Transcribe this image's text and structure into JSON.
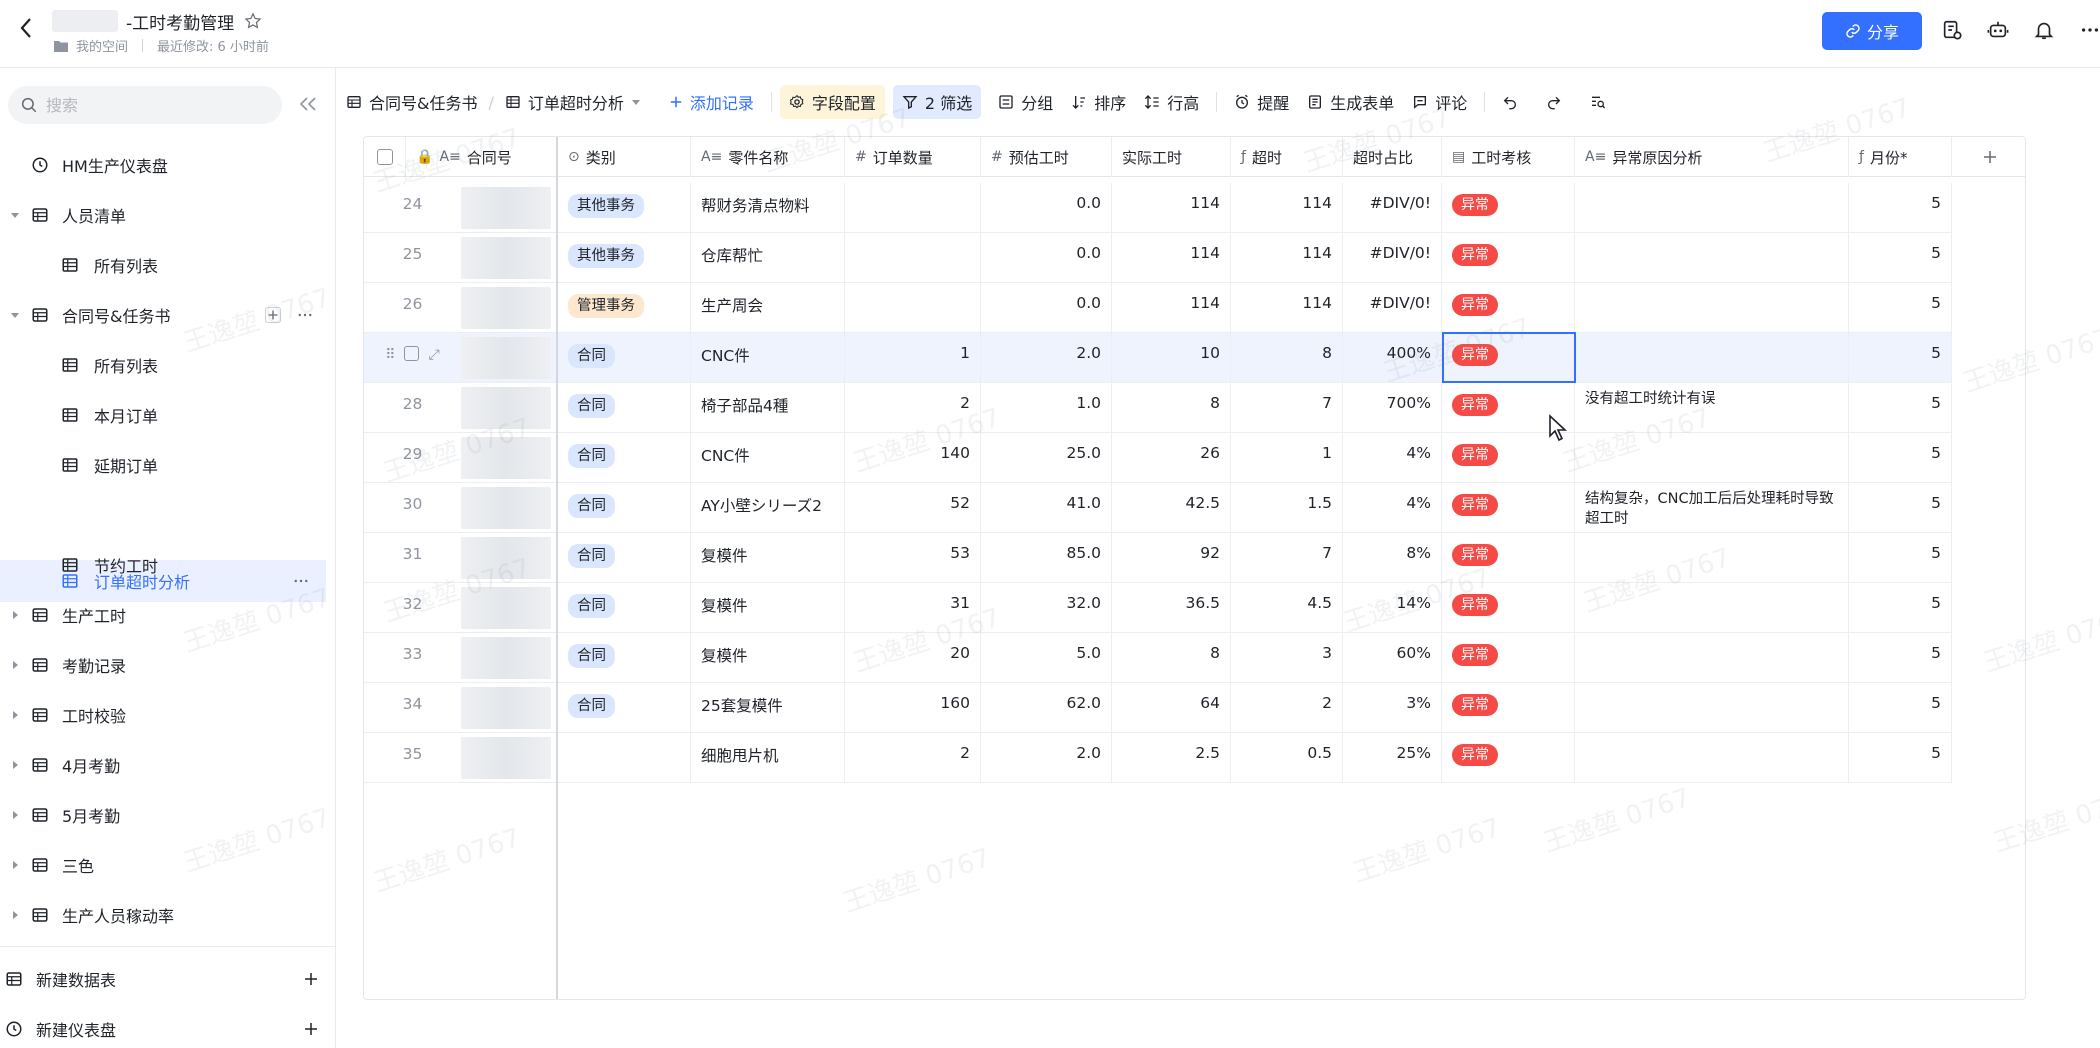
{
  "header": {
    "title": "-工时考勤管理",
    "meta_space": "我的空间",
    "meta_modified": "最近修改: 6 小时前",
    "share_label": "分享"
  },
  "colors": {
    "accent": "#3370ff",
    "abnormal": "#f54a45"
  },
  "sidebar": {
    "search_placeholder": "搜索",
    "items": [
      {
        "label": "HM生产仪表盘",
        "icon": "dashboard-icon"
      },
      {
        "label": "人员清单",
        "icon": "table-icon",
        "expanded": true
      },
      {
        "label": "所有列表",
        "icon": "grid-view-icon"
      },
      {
        "label": "合同号&任务书",
        "icon": "table-icon",
        "expanded": true
      },
      {
        "label": "所有列表",
        "icon": "grid-view-icon"
      },
      {
        "label": "本月订单",
        "icon": "grid-view-icon"
      },
      {
        "label": "延期订单",
        "icon": "grid-view-icon"
      },
      {
        "label": "订单超时分析",
        "icon": "grid-view-icon",
        "active": true
      },
      {
        "label": "节约工时",
        "icon": "grid-view-icon"
      },
      {
        "label": "生产工时",
        "icon": "table-icon"
      },
      {
        "label": "考勤记录",
        "icon": "table-icon"
      },
      {
        "label": "工时校验",
        "icon": "table-icon"
      },
      {
        "label": "4月考勤",
        "icon": "table-icon"
      },
      {
        "label": "5月考勤",
        "icon": "table-icon"
      },
      {
        "label": "三色",
        "icon": "table-icon"
      },
      {
        "label": "生产人员稼动率",
        "icon": "table-icon"
      }
    ],
    "new_table": "新建数据表",
    "new_dashboard": "新建仪表盘"
  },
  "toolbar": {
    "table_name": "合同号&任务书",
    "view_name": "订单超时分析",
    "add_record": "添加记录",
    "field_config": "字段配置",
    "filter": "2 筛选",
    "group": "分组",
    "sort": "排序",
    "row_height": "行高",
    "remind": "提醒",
    "form": "生成表单",
    "comment": "评论"
  },
  "columns": [
    "合同号",
    "类别",
    "零件名称",
    "订单数量",
    "预估工时",
    "实际工时",
    "超时",
    "超时占比",
    "工时考核",
    "异常原因分析",
    "月份*"
  ],
  "rows": [
    {
      "idx": "24",
      "category": "其他事务",
      "cat_color": "blue",
      "part": "帮财务清点物料",
      "qty": "",
      "est": "0.0",
      "actual": "114",
      "over": "114",
      "ratio": "#DIV/0!",
      "check": "异常",
      "reason": "",
      "month": "5"
    },
    {
      "idx": "25",
      "category": "其他事务",
      "cat_color": "blue",
      "part": "仓库帮忙",
      "qty": "",
      "est": "0.0",
      "actual": "114",
      "over": "114",
      "ratio": "#DIV/0!",
      "check": "异常",
      "reason": "",
      "month": "5"
    },
    {
      "idx": "26",
      "category": "管理事务",
      "cat_color": "orange",
      "part": "生产周会",
      "qty": "",
      "est": "0.0",
      "actual": "114",
      "over": "114",
      "ratio": "#DIV/0!",
      "check": "异常",
      "reason": "",
      "month": "5"
    },
    {
      "idx": "",
      "category": "合同",
      "cat_color": "blue",
      "part": "CNC件",
      "qty": "1",
      "est": "2.0",
      "actual": "10",
      "over": "8",
      "ratio": "400%",
      "check": "异常",
      "reason": "",
      "month": "5",
      "selected": true
    },
    {
      "idx": "28",
      "category": "合同",
      "cat_color": "blue",
      "part": "椅子部品4種",
      "qty": "2",
      "est": "1.0",
      "actual": "8",
      "over": "7",
      "ratio": "700%",
      "check": "异常",
      "reason": "没有超工时统计有误",
      "month": "5"
    },
    {
      "idx": "29",
      "category": "合同",
      "cat_color": "blue",
      "part": "CNC件",
      "qty": "140",
      "est": "25.0",
      "actual": "26",
      "over": "1",
      "ratio": "4%",
      "check": "异常",
      "reason": "",
      "month": "5"
    },
    {
      "idx": "30",
      "category": "合同",
      "cat_color": "blue",
      "part": "AY小壁シリーズ2",
      "qty": "52",
      "est": "41.0",
      "actual": "42.5",
      "over": "1.5",
      "ratio": "4%",
      "check": "异常",
      "reason": "结构复杂，CNC加工后后处理耗时导致超工时",
      "month": "5"
    },
    {
      "idx": "31",
      "category": "合同",
      "cat_color": "blue",
      "part": "复模件",
      "qty": "53",
      "est": "85.0",
      "actual": "92",
      "over": "7",
      "ratio": "8%",
      "check": "异常",
      "reason": "",
      "month": "5"
    },
    {
      "idx": "32",
      "category": "合同",
      "cat_color": "blue",
      "part": "复模件",
      "qty": "31",
      "est": "32.0",
      "actual": "36.5",
      "over": "4.5",
      "ratio": "14%",
      "check": "异常",
      "reason": "",
      "month": "5"
    },
    {
      "idx": "33",
      "category": "合同",
      "cat_color": "blue",
      "part": "复模件",
      "qty": "20",
      "est": "5.0",
      "actual": "8",
      "over": "3",
      "ratio": "60%",
      "check": "异常",
      "reason": "",
      "month": "5"
    },
    {
      "idx": "34",
      "category": "合同",
      "cat_color": "blue",
      "part": "25套复模件",
      "qty": "160",
      "est": "62.0",
      "actual": "64",
      "over": "2",
      "ratio": "3%",
      "check": "异常",
      "reason": "",
      "month": "5"
    },
    {
      "idx": "35",
      "category": "",
      "cat_color": "blue",
      "part": "细胞甩片机",
      "qty": "2",
      "est": "2.0",
      "actual": "2.5",
      "over": "0.5",
      "ratio": "25%",
      "check": "异常",
      "reason": "",
      "month": "5"
    }
  ],
  "watermark": "王逸堃 0767"
}
